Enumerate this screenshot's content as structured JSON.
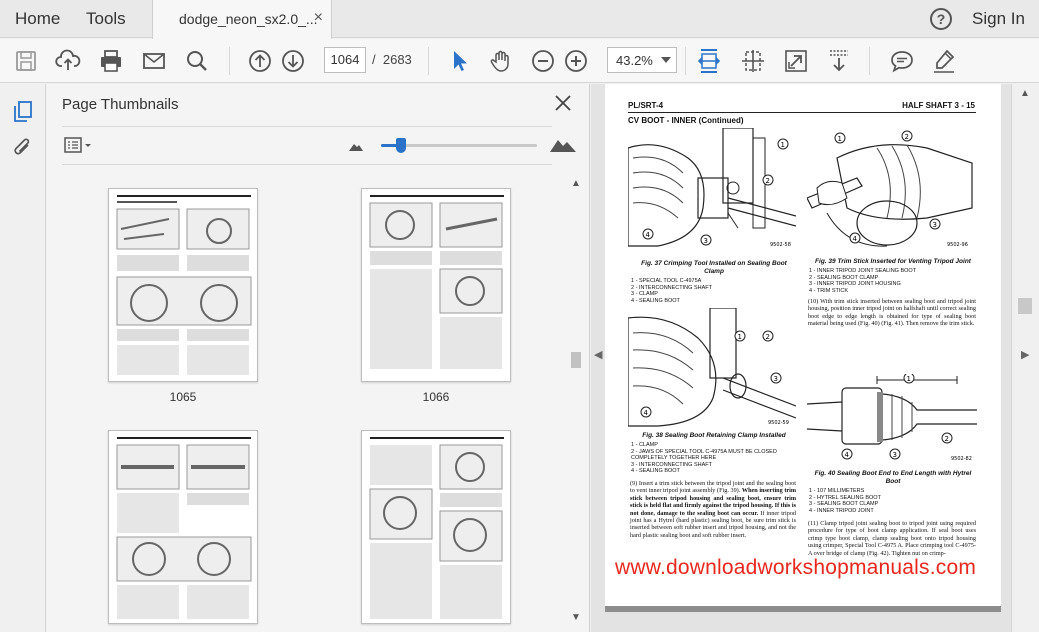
{
  "menubar": {
    "home_label": "Home",
    "tools_label": "Tools",
    "document_tab": "dodge_neon_sx2.0_...",
    "tab_close": "×",
    "help_label": "?",
    "signin_label": "Sign In"
  },
  "toolbar": {
    "current_page": "1064",
    "page_separator": "/",
    "total_pages": "2683",
    "zoom_level": "43.2%",
    "icons": [
      "save-icon",
      "upload-icon",
      "print-icon",
      "email-icon",
      "search-icon",
      "page-up-icon",
      "page-down-icon",
      "select-cursor-icon",
      "hand-tool-icon",
      "zoom-out-icon",
      "zoom-in-icon",
      "fit-width-icon",
      "fit-page-icon",
      "full-screen-icon",
      "scroll-mode-icon",
      "comment-icon",
      "highlight-icon"
    ],
    "accent_color": "#2a73c9"
  },
  "thumbnails_panel": {
    "title": "Page Thumbnails",
    "close_label": "✕",
    "slider_level": 0.13,
    "thumbnails": [
      {
        "label": "1065"
      },
      {
        "label": "1066"
      },
      {
        "label": ""
      },
      {
        "label": ""
      }
    ]
  },
  "document": {
    "header_left": "PL/SRT-4",
    "header_right": "HALF SHAFT   3 - 15",
    "section_title": "CV BOOT - INNER (Continued)",
    "figures": [
      {
        "caption": "Fig. 37 Crimping Tool Installed on Sealing Boot Clamp",
        "code": "9502-58",
        "legend": [
          "1 - SPECIAL TOOL C-4975A",
          "2 - INTERCONNECTING SHAFT",
          "3 - CLAMP",
          "4 - SEALING BOOT"
        ]
      },
      {
        "caption": "Fig. 38 Sealing Boot Retaining Clamp Installed",
        "code": "9502-59",
        "legend": [
          "1 - CLAMP",
          "2 - JAWS OF SPECIAL TOOL C-4975A MUST BE CLOSED COMPLETELY TOGETHER HERE",
          "3 - INTERCONNECTING SHAFT",
          "4 - SEALING BOOT"
        ]
      },
      {
        "caption": "Fig. 39 Trim Stick Inserted for Venting Tripod Joint",
        "code": "9502-96",
        "legend": [
          "1 - INNER TRIPOD JOINT SEALING BOOT",
          "2 - SEALING BOOT CLAMP",
          "3 - INNER TRIPOD JOINT HOUSING",
          "4 - TRIM STICK"
        ]
      },
      {
        "caption": "Fig. 40 Sealing Boot End to End Length with Hytrel Boot",
        "code": "9502-82",
        "legend": [
          "1 - 107 MILLIMETERS",
          "2 - HYTREL SEALING BOOT",
          "3 - SEALING BOOT CLAMP",
          "4 - INNER TRIPOD JOINT"
        ]
      }
    ],
    "para_10": "(10) With trim stick inserted between sealing boot and tripod joint housing, position inner tripod joint on halfshaft until correct sealing boot edge to edge length is obtained for type of sealing boot material being used (Fig. 40) (Fig. 41). Then remove the trim stick.",
    "para_9_a": "(9) Insert a trim stick between the tripod joint and the sealing boot to vent inner tripod joint assembly (Fig. 39).",
    "para_9_b": "When inserting trim stick between tripod housing and sealing boot, ensure trim stick is held flat and firmly against the tripod housing. If this is not done, damage to the sealing boot can occur.",
    "para_9_c": "If inner tripod joint has a Hytrel (hard plastic) sealing boot, be sure trim stick is inserted between soft rubber insert and tripod housing, and not the hard plastic sealing boot and soft rubber insert.",
    "para_11": "(11) Clamp tripod joint sealing boot to tripod joint using required procedure for type of boot clamp application. If seal boot uses crimp type boot clamp, clamp sealing boot onto tripod housing using crimper, Special Tool C-4975 A. Place crimping tool C-4975-A over bridge of clamp (Fig. 42). Tighten nut on crimp-",
    "watermark": "www.downloadworkshopmanuals.com"
  }
}
